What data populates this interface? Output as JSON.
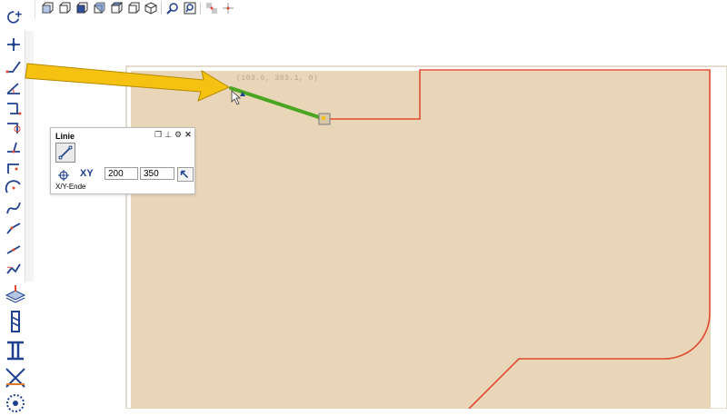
{
  "top_toolbar": {
    "icons": [
      "view-front-icon",
      "view-back-icon",
      "view-left-icon",
      "view-right-icon",
      "view-top-icon",
      "view-bottom-icon",
      "view-iso-icon",
      "zoom-window-icon",
      "zoom-all-icon",
      "snap-grid-icon",
      "snap-axis-icon"
    ]
  },
  "left_toolbar": {
    "icons": [
      "select-cursor-icon",
      "point-icon",
      "line-icon",
      "line-angle-icon",
      "line-parallel-icon",
      "line-tangent-icon",
      "line-perpendicular-icon",
      "line-offset-icon",
      "arc-icon",
      "spline-icon",
      "polyline-icon",
      "polyline-2-icon",
      "chamfer-icon",
      "stock-layers-icon",
      "drill-tool-icon",
      "fixture-icon",
      "saw-cross-icon",
      "gear-cutter-icon"
    ]
  },
  "canvas": {
    "coordinate_readout": "(103.6, 383.1, 0)",
    "colors": {
      "sheet": "#e9d6b9",
      "contour": "#e04a2f",
      "active_line": "#4aa520",
      "arrow": "#f5c211"
    }
  },
  "line_panel": {
    "title": "Linie",
    "mode_label": "XY",
    "x_value": "200",
    "y_value": "350",
    "field_label": "X/Y-Ende"
  }
}
